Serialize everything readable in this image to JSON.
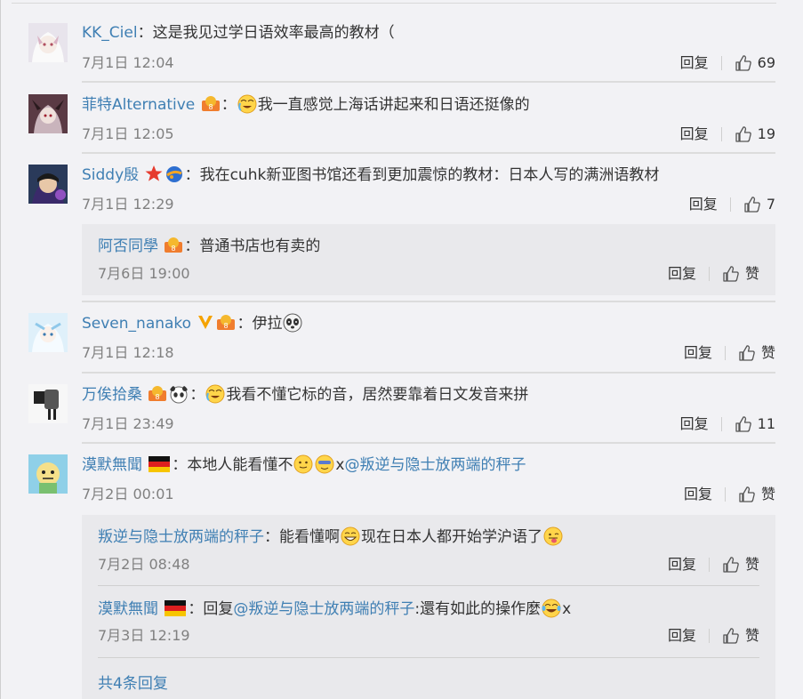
{
  "comments": [
    {
      "user": "KK_Ciel",
      "text": "这是我见过学日语效率最高的教材（",
      "time": "7月1日 12:04",
      "reply": "回复",
      "likes": "69"
    },
    {
      "user": "菲特Alternative",
      "text": "我一直感觉上海话讲起来和日语还挺像的",
      "time": "7月1日 12:05",
      "reply": "回复",
      "likes": "19"
    },
    {
      "user": "Siddy殷",
      "text": "我在cuhk新亚图书馆还看到更加震惊的教材：日本人写的满洲语教材",
      "time": "7月1日 12:29",
      "reply": "回复",
      "likes": "7",
      "sub_replies": [
        {
          "user": "阿否同學",
          "text": "普通书店也有卖的",
          "time": "7月6日 19:00",
          "reply": "回复",
          "likes": "赞"
        }
      ]
    },
    {
      "user": "Seven_nanako",
      "text": "伊拉",
      "time": "7月1日 12:18",
      "reply": "回复",
      "likes": "赞"
    },
    {
      "user": "万俟拾桑",
      "text": "我看不懂它标的音，居然要靠着日文发音来拼",
      "time": "7月1日 23:49",
      "reply": "回复",
      "likes": "11"
    },
    {
      "user": "漠默無聞",
      "text_a": "本地人能看懂不",
      "text_b": "x",
      "mention": "@叛逆与隐士放两端的秤子",
      "time": "7月2日 00:01",
      "reply": "回复",
      "likes": "赞",
      "sub_replies": [
        {
          "user": "叛逆与隐士放两端的秤子",
          "text_a": "能看懂啊",
          "text_b": "现在日本人都开始学沪语了",
          "time": "7月2日 08:48",
          "reply": "回复",
          "likes": "赞"
        },
        {
          "user": "漠默無聞",
          "text_a": "回复",
          "mention": "@叛逆与隐士放两端的秤子",
          "text_b": ":還有如此的操作麼",
          "text_c": "x",
          "time": "7月3日 12:19",
          "reply": "回复",
          "likes": "赞"
        }
      ],
      "more": "共4条回复"
    }
  ],
  "colon": "：",
  "colors": {
    "link": "#3f7fb3",
    "text": "#333333",
    "time": "#808080",
    "subbox": "#e9e9ec"
  },
  "icons": [
    "thumb-up-icon",
    "badge-icon",
    "weibo-vip-icon",
    "germany-flag-icon",
    "emoji-icon"
  ]
}
